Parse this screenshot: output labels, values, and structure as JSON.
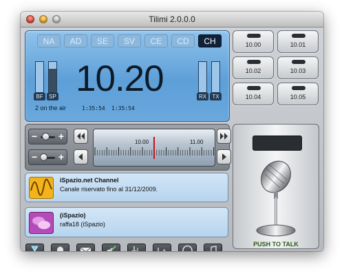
{
  "window": {
    "title": "Tilimi 2.0.0.0"
  },
  "lcd": {
    "channels": [
      {
        "label": "NA",
        "active": false
      },
      {
        "label": "AD",
        "active": false
      },
      {
        "label": "SE",
        "active": false
      },
      {
        "label": "SV",
        "active": false
      },
      {
        "label": "CE",
        "active": false
      },
      {
        "label": "CD",
        "active": false
      },
      {
        "label": "CH",
        "active": true
      }
    ],
    "frequency": "10.20",
    "status": "2 on the air",
    "time_1": "1:35:54",
    "time_2": "1:35:54",
    "meters": {
      "bf": {
        "label": "BF",
        "level": 0.0
      },
      "sp": {
        "label": "SP",
        "level": 0.78
      },
      "rx": {
        "label": "RX",
        "level": 0.0
      },
      "tx": {
        "label": "TX",
        "level": 0.0
      }
    }
  },
  "presets": [
    "10.00",
    "10.01",
    "10.02",
    "10.03",
    "10.04",
    "10.05"
  ],
  "tuner": {
    "left_label": "10.00",
    "right_label": "11.00"
  },
  "volume_slider": {
    "value": 0.35
  },
  "squelch_slider": {
    "value": 0.2
  },
  "cards": {
    "channel": {
      "title": "iSpazio.net Channel",
      "text": "Canale riservato fino al 31/12/2009."
    },
    "user": {
      "title": "(iSpazio)",
      "text": "raffa18 (iSpazio)"
    }
  },
  "push_to_talk": "PUSH TO TALK",
  "colors": {
    "lcd": "#6aa8dd",
    "active_channel": "#0f2038",
    "ptt_text": "#2b5a14"
  },
  "toolbar_icons": [
    "hourglass-icon",
    "bell-icon",
    "mail-icon",
    "mute-icon",
    "download-icon",
    "text-icon",
    "headset-icon",
    "music-note-icon"
  ]
}
